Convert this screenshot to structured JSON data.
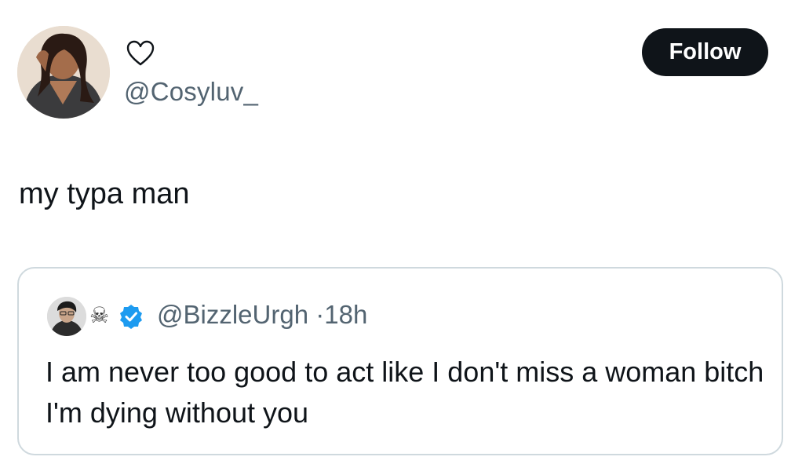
{
  "author": {
    "handle": "@Cosyluv_",
    "display_name_icon": "heart-outline-icon",
    "follow_label": "Follow"
  },
  "tweet": {
    "text": "my typa man"
  },
  "quoted_tweet": {
    "emoji": "☠",
    "badge_icon": "verified-badge-icon",
    "handle": "@BizzleUrgh",
    "separator": "·",
    "time": "18h",
    "text": "I am never too good to act like I don't miss a woman bitch I'm dying without you"
  },
  "colors": {
    "text_primary": "#0f1419",
    "text_secondary": "#536471",
    "button_bg": "#0f1419",
    "verified_blue": "#1d9bf0",
    "card_border": "#cfd9de"
  }
}
